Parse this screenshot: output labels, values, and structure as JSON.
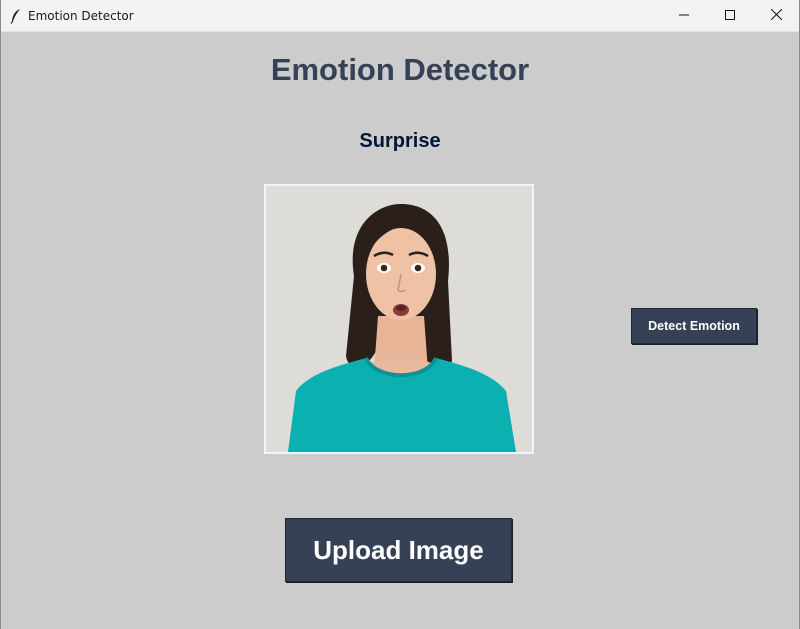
{
  "window": {
    "title": "Emotion Detector",
    "controls": [
      "minimize-icon",
      "maximize-icon",
      "close-icon"
    ]
  },
  "header": {
    "heading": "Emotion Detector"
  },
  "result": {
    "label": "Surprise"
  },
  "buttons": {
    "detect_label": "Detect Emotion",
    "upload_label": "Upload Image"
  },
  "image": {
    "description_icon": "portrait-image"
  },
  "colors": {
    "background": "#cccccc",
    "heading": "#364156",
    "result_text": "#011638",
    "button_bg": "#364156",
    "button_text": "#ffffff"
  }
}
